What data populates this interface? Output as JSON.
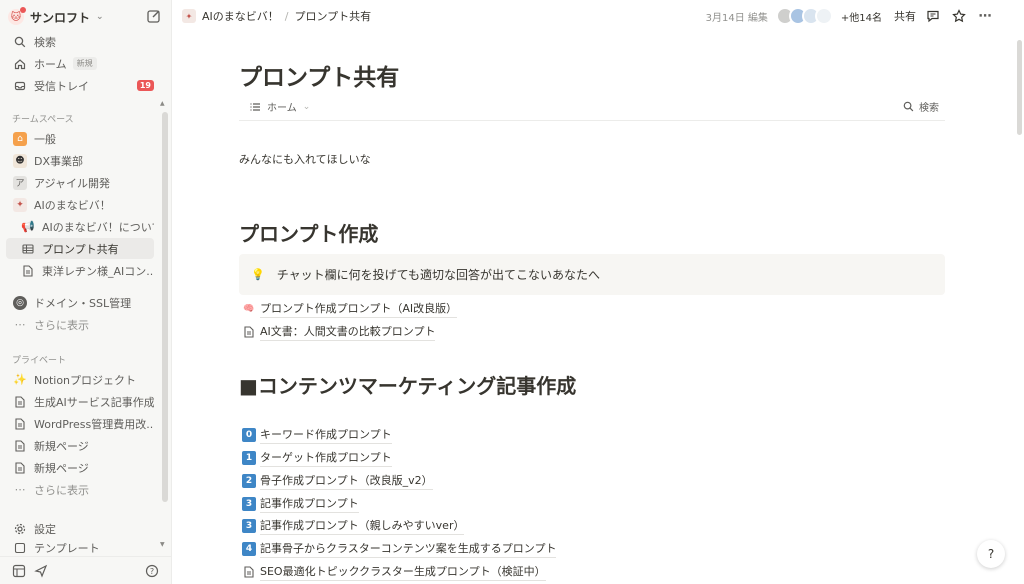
{
  "workspace": {
    "name": "サンロフト",
    "avatar": "🐱"
  },
  "sidebar": {
    "top": [
      {
        "label": "検索"
      },
      {
        "label": "ホーム",
        "tag": "新規"
      },
      {
        "label": "受信トレイ",
        "count": "19"
      }
    ],
    "team_heading": "チームスペース",
    "team": [
      {
        "label": "一般"
      },
      {
        "label": "DX事業部"
      },
      {
        "label": "アジャイル開発"
      },
      {
        "label": "AIのまなビバ！"
      },
      {
        "label": "AIのまなビバ！について"
      },
      {
        "label": "プロンプト共有"
      },
      {
        "label": "東洋レヂン様_AIコン..."
      },
      {
        "label": "ドメイン・SSL管理"
      },
      {
        "label": "さらに表示"
      }
    ],
    "private_heading": "プライベート",
    "private": [
      {
        "label": "Notionプロジェクト"
      },
      {
        "label": "生成AIサービス記事作成"
      },
      {
        "label": "WordPress管理費用改..."
      },
      {
        "label": "新規ページ"
      },
      {
        "label": "新規ページ"
      },
      {
        "label": "さらに表示"
      }
    ],
    "bottom": [
      {
        "label": "設定"
      },
      {
        "label": "テンプレート"
      }
    ]
  },
  "topbar": {
    "breadcrumb": [
      "AIのまなビバ！",
      "プロンプト共有"
    ],
    "edited": "3月14日 編集",
    "others": "+他14名",
    "share": "共有"
  },
  "page": {
    "title": "プロンプト共有",
    "view_label": "ホーム",
    "search_label": "検索",
    "intro": "みんなにも入れてほしいな",
    "section1": "プロンプト作成",
    "callout": "チャット欄に何を投げても適切な回答が出てこないあなたへ",
    "links1": [
      {
        "icon": "🧠",
        "label": "プロンプト作成プロンプト（AI改良版）"
      },
      {
        "icon": "📄",
        "label": "AI文書：人間文書の比較プロンプト"
      }
    ],
    "section2": "■コンテンツマーケティング記事作成",
    "links2": [
      {
        "icon": "0",
        "label": "キーワード作成プロンプト"
      },
      {
        "icon": "1",
        "label": "ターゲット作成プロンプト"
      },
      {
        "icon": "2",
        "label": "骨子作成プロンプト（改良版_v2）"
      },
      {
        "icon": "3",
        "label": "記事作成プロンプト"
      },
      {
        "icon": "3",
        "label": "記事作成プロンプト（親しみやすいver）"
      },
      {
        "icon": "4",
        "label": "記事骨子からクラスターコンテンツ案を生成するプロンプト"
      },
      {
        "icon": "📄",
        "label": "SEO最適化トピッククラスター生成プロンプト（検証中）"
      }
    ]
  }
}
